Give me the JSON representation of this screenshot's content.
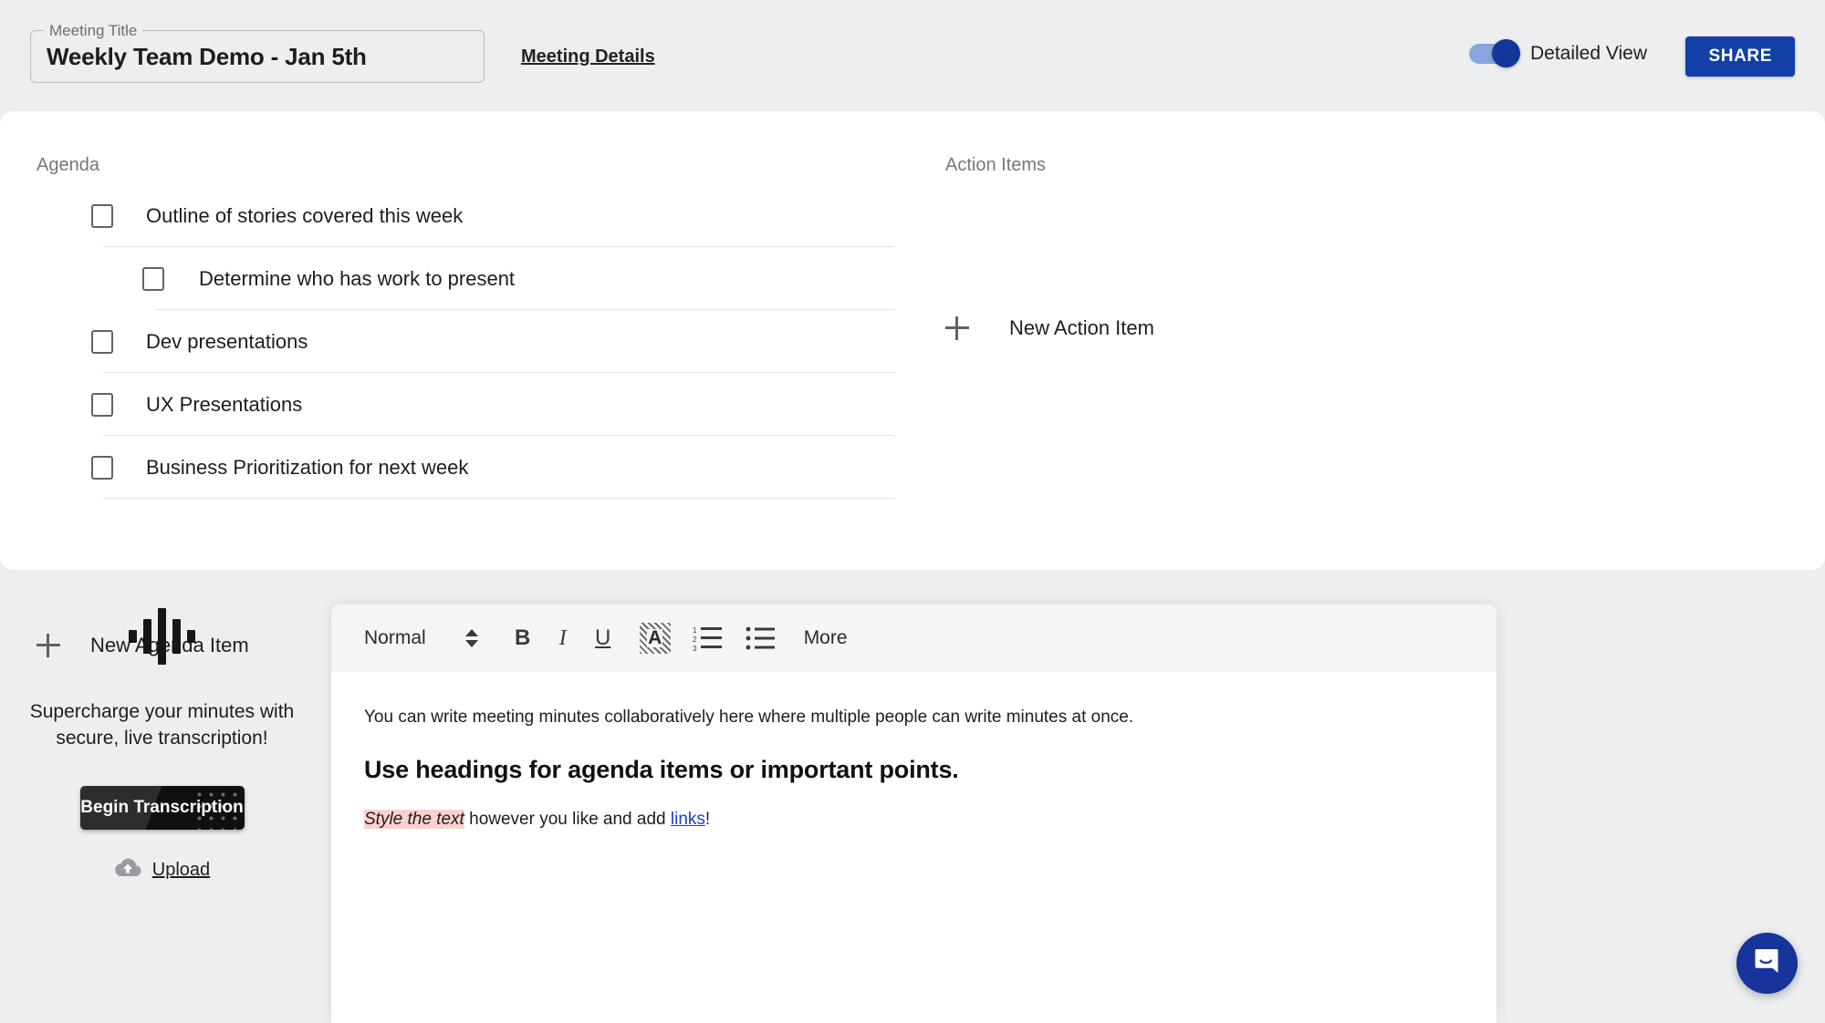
{
  "header": {
    "title_legend": "Meeting Title",
    "title_value": "Weekly Team Demo - Jan 5th",
    "title_placeholder": "Meeting Title",
    "details_link": "Meeting Details",
    "toggle_label": "Detailed View",
    "toggle_state": "on",
    "share_label": "SHARE",
    "accent_color": "#1240a8"
  },
  "agenda": {
    "heading": "Agenda",
    "items": [
      {
        "label": "Outline of stories covered this week",
        "checked": false,
        "level": 0
      },
      {
        "label": "Determine who has work to present",
        "checked": false,
        "level": 1
      },
      {
        "label": "Dev presentations",
        "checked": false,
        "level": 0
      },
      {
        "label": "UX Presentations",
        "checked": false,
        "level": 0
      },
      {
        "label": "Business Prioritization for next week",
        "checked": false,
        "level": 0
      }
    ],
    "new_item_label": "New Agenda Item"
  },
  "action_items": {
    "heading": "Action Items",
    "items": [],
    "new_item_label": "New Action Item"
  },
  "transcription": {
    "tagline": "Supercharge your minutes with secure, live transcription!",
    "begin_label": "Begin Transcription",
    "upload_label": "Upload",
    "waveform_bars": [
      14,
      38,
      62,
      38,
      14
    ]
  },
  "editor": {
    "toolbar": {
      "style_value": "Normal",
      "bold_label": "B",
      "italic_label": "I",
      "underline_label": "U",
      "highlight_label": "A",
      "more_label": "More"
    },
    "content": {
      "paragraph": "You can write meeting minutes collaboratively here where multiple people can write minutes at once.",
      "heading": "Use headings for agenda items or important points.",
      "styled_lead": "Style the text",
      "styled_mid": " however you like and add ",
      "styled_link": "links",
      "styled_tail": "!",
      "highlight_color": "#fbd0d0",
      "link_color": "#1a3fd0"
    }
  },
  "chat": {
    "tooltip": "Open chat"
  }
}
